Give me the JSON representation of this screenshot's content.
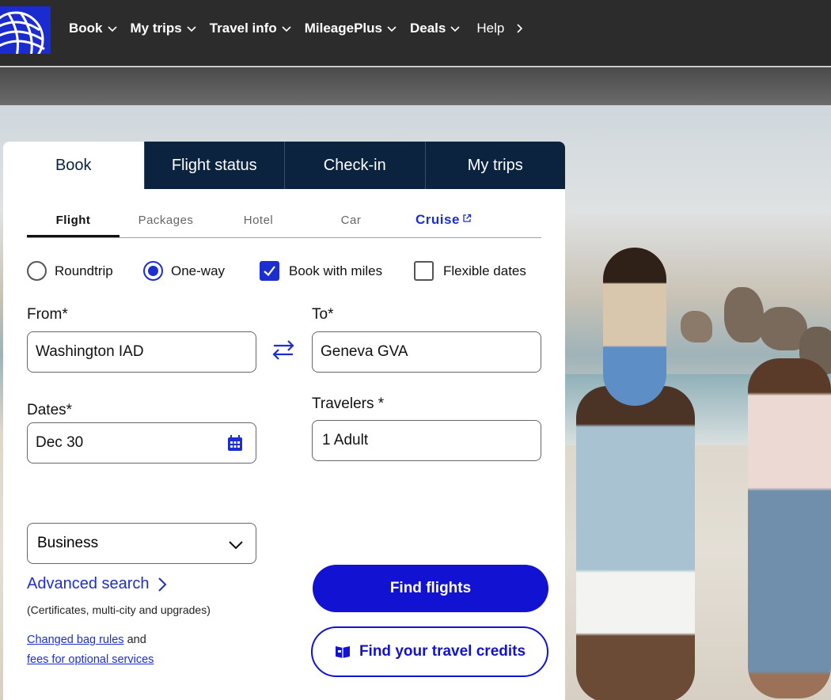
{
  "nav": {
    "items": [
      {
        "label": "Book"
      },
      {
        "label": "My trips"
      },
      {
        "label": "Travel info"
      },
      {
        "label": "MileagePlus"
      },
      {
        "label": "Deals"
      }
    ],
    "help": "Help"
  },
  "widget": {
    "main_tabs": [
      {
        "label": "Book"
      },
      {
        "label": "Flight status"
      },
      {
        "label": "Check-in"
      },
      {
        "label": "My trips"
      }
    ],
    "sub_tabs": [
      {
        "label": "Flight"
      },
      {
        "label": "Packages"
      },
      {
        "label": "Hotel"
      },
      {
        "label": "Car"
      },
      {
        "label": "Cruise"
      }
    ],
    "trip_options": {
      "roundtrip": "Roundtrip",
      "oneway": "One-way",
      "miles": "Book with miles",
      "flexible": "Flexible dates"
    },
    "from_label": "From*",
    "from_value": "Washington IAD",
    "to_label": "To*",
    "to_value": "Geneva GVA",
    "dates_label": "Dates*",
    "dates_value": "Dec 30",
    "travelers_label": "Travelers *",
    "travelers_value": "1 Adult",
    "cabin_value": "Business",
    "advanced_search": "Advanced search",
    "advanced_note": "(Certificates, multi-city and upgrades)",
    "bag_rules_link": "Changed bag rules",
    "and_text": "and",
    "fees_link": "fees for optional services",
    "find_flights": "Find flights",
    "travel_credits": "Find your travel credits"
  },
  "colors": {
    "navy": "#0c2340",
    "accent": "#1d2ed0"
  }
}
